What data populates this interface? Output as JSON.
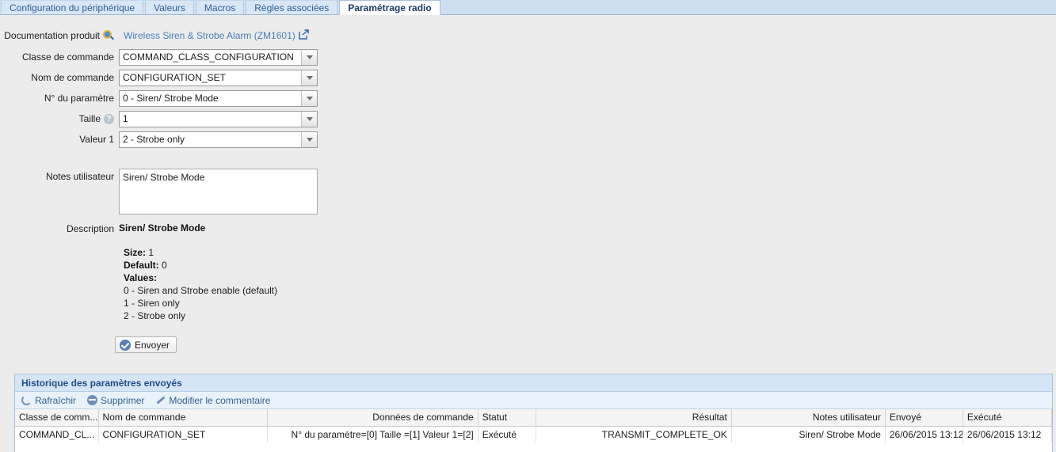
{
  "tabs": [
    {
      "label": "Configuration du périphérique",
      "active": false
    },
    {
      "label": "Valeurs",
      "active": false
    },
    {
      "label": "Macros",
      "active": false
    },
    {
      "label": "Règles associées",
      "active": false
    },
    {
      "label": "Paramétrage radio",
      "active": true
    }
  ],
  "form": {
    "documentation_label": "Documentation produit",
    "documentation_link": "Wireless Siren & Strobe Alarm (ZM1601)",
    "search_icon": "search-icon",
    "external_link_icon": "external-link-icon",
    "fields": [
      {
        "label": "Classe de commande",
        "value": "COMMAND_CLASS_CONFIGURATION",
        "help": false
      },
      {
        "label": "Nom de commande",
        "value": "CONFIGURATION_SET",
        "help": false
      },
      {
        "label": "N° du paramètre",
        "value": "0 - Siren/ Strobe Mode",
        "help": false
      },
      {
        "label": "Taille",
        "value": "1",
        "help": true
      },
      {
        "label": "Valeur 1",
        "value": "2 - Strobe only",
        "help": false
      }
    ],
    "notes_label": "Notes utilisateur",
    "notes_value": "Siren/ Strobe Mode",
    "description_label": "Description",
    "description_title": "Siren/ Strobe Mode",
    "description": {
      "size_label": "Size:",
      "size_value": "1",
      "default_label": "Default:",
      "default_value": "0",
      "values_label": "Values:",
      "values": [
        "0 - Siren and Strobe enable (default)",
        "1 - Siren only",
        "2 - Strobe only"
      ]
    },
    "send_button": "Envoyer"
  },
  "history": {
    "title": "Historique des paramètres envoyés",
    "toolbar": [
      {
        "label": "Rafraîchir",
        "icon": "refresh-icon"
      },
      {
        "label": "Supprimer",
        "icon": "minus-circle-icon"
      },
      {
        "label": "Modifier le commentaire",
        "icon": "pencil-icon"
      }
    ],
    "columns": [
      {
        "label": "Classe de comm...",
        "align": "left"
      },
      {
        "label": "Nom de commande",
        "align": "left"
      },
      {
        "label": "Données de commande",
        "align": "right"
      },
      {
        "label": "Statut",
        "align": "left"
      },
      {
        "label": "Résultat",
        "align": "right"
      },
      {
        "label": "Notes utilisateur",
        "align": "right"
      },
      {
        "label": "Envoyé",
        "align": "left"
      },
      {
        "label": "Exécuté",
        "align": "left"
      }
    ],
    "rows": [
      {
        "classe": "COMMAND_CL...",
        "nom": "CONFIGURATION_SET",
        "donnees": "N° du paramètre=[0] Taille =[1] Valeur 1=[2]",
        "statut": "Exécuté",
        "resultat": "TRANSMIT_COMPLETE_OK",
        "notes": "Siren/ Strobe Mode",
        "envoye": "26/06/2015 13:12",
        "execute": "26/06/2015 13:12"
      }
    ]
  },
  "colors": {
    "tab_bar": "#cfdff2",
    "active_tab_text": "#1a3c66",
    "link": "#4a7fb5",
    "panel_header_bg": "#d6e5f6",
    "panel_header_text": "#1f4e84",
    "page_bg": "#ececec"
  }
}
